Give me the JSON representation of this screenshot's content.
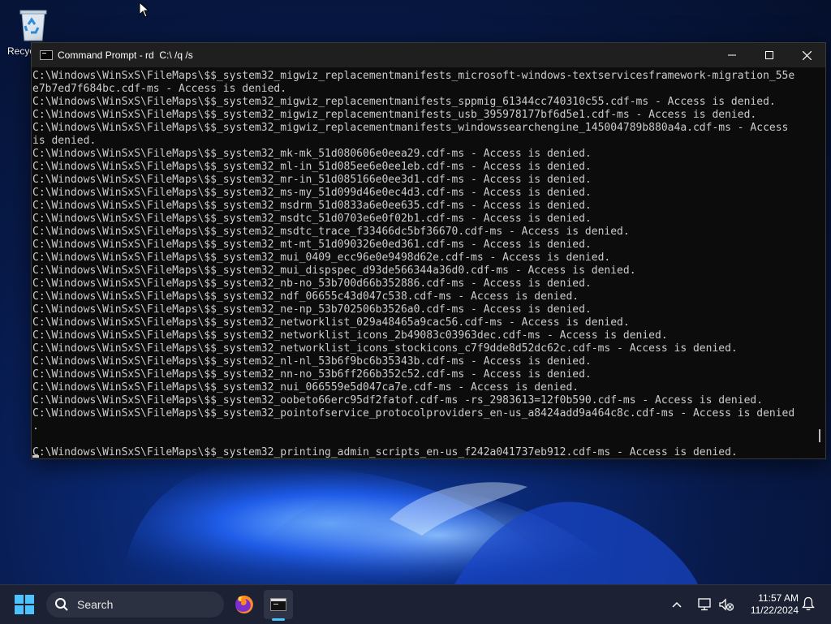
{
  "desktop": {
    "icons": [
      {
        "label": "Recyc",
        "icon": "recycle-bin-icon"
      }
    ]
  },
  "window": {
    "title": "Command Prompt - rd  C:\\ /q /s",
    "icon": "command-prompt-icon",
    "buttons": {
      "minimize": "minimize-icon",
      "maximize": "maximize-icon",
      "close": "close-icon"
    }
  },
  "console": {
    "lines": [
      "C:\\Windows\\WinSxS\\FileMaps\\$$_system32_migwiz_replacementmanifests_microsoft-windows-textservicesframework-migration_55e",
      "e7b7ed7f684bc.cdf-ms - Access is denied.",
      "C:\\Windows\\WinSxS\\FileMaps\\$$_system32_migwiz_replacementmanifests_sppmig_61344cc740310c55.cdf-ms - Access is denied.",
      "C:\\Windows\\WinSxS\\FileMaps\\$$_system32_migwiz_replacementmanifests_usb_395978177bf6d5e1.cdf-ms - Access is denied.",
      "C:\\Windows\\WinSxS\\FileMaps\\$$_system32_migwiz_replacementmanifests_windowssearchengine_145004789b880a4a.cdf-ms - Access",
      "is denied.",
      "C:\\Windows\\WinSxS\\FileMaps\\$$_system32_mk-mk_51d080606e0eea29.cdf-ms - Access is denied.",
      "C:\\Windows\\WinSxS\\FileMaps\\$$_system32_ml-in_51d085ee6e0ee1eb.cdf-ms - Access is denied.",
      "C:\\Windows\\WinSxS\\FileMaps\\$$_system32_mr-in_51d085166e0ee3d1.cdf-ms - Access is denied.",
      "C:\\Windows\\WinSxS\\FileMaps\\$$_system32_ms-my_51d099d46e0ec4d3.cdf-ms - Access is denied.",
      "C:\\Windows\\WinSxS\\FileMaps\\$$_system32_msdrm_51d0833a6e0ee635.cdf-ms - Access is denied.",
      "C:\\Windows\\WinSxS\\FileMaps\\$$_system32_msdtc_51d0703e6e0f02b1.cdf-ms - Access is denied.",
      "C:\\Windows\\WinSxS\\FileMaps\\$$_system32_msdtc_trace_f33466dc5bf36670.cdf-ms - Access is denied.",
      "C:\\Windows\\WinSxS\\FileMaps\\$$_system32_mt-mt_51d090326e0ed361.cdf-ms - Access is denied.",
      "C:\\Windows\\WinSxS\\FileMaps\\$$_system32_mui_0409_ecc96e0e9498d62e.cdf-ms - Access is denied.",
      "C:\\Windows\\WinSxS\\FileMaps\\$$_system32_mui_dispspec_d93de566344a36d0.cdf-ms - Access is denied.",
      "C:\\Windows\\WinSxS\\FileMaps\\$$_system32_nb-no_53b700d66b352886.cdf-ms - Access is denied.",
      "C:\\Windows\\WinSxS\\FileMaps\\$$_system32_ndf_06655c43d047c538.cdf-ms - Access is denied.",
      "C:\\Windows\\WinSxS\\FileMaps\\$$_system32_ne-np_53b702506b3526a0.cdf-ms - Access is denied.",
      "C:\\Windows\\WinSxS\\FileMaps\\$$_system32_networklist_029a48465a9cac56.cdf-ms - Access is denied.",
      "C:\\Windows\\WinSxS\\FileMaps\\$$_system32_networklist_icons_2b49083c03963dec.cdf-ms - Access is denied.",
      "C:\\Windows\\WinSxS\\FileMaps\\$$_system32_networklist_icons_stockicons_c7f9dde8d52dc62c.cdf-ms - Access is denied.",
      "C:\\Windows\\WinSxS\\FileMaps\\$$_system32_nl-nl_53b6f9bc6b35343b.cdf-ms - Access is denied.",
      "C:\\Windows\\WinSxS\\FileMaps\\$$_system32_nn-no_53b6ff266b352c52.cdf-ms - Access is denied.",
      "C:\\Windows\\WinSxS\\FileMaps\\$$_system32_nui_066559e5d047ca7e.cdf-ms - Access is denied.",
      "C:\\Windows\\WinSxS\\FileMaps\\$$_system32_oobeto66erc95df2fatof.cdf-ms -rs_2983613=12f0b590.cdf-ms - Access is denied.",
      "C:\\Windows\\WinSxS\\FileMaps\\$$_system32_pointofservice_protocolproviders_en-us_a8424add9a464c8c.cdf-ms - Access is denied",
      ".",
      "",
      "C:\\Windows\\WinSxS\\FileMaps\\$$_system32_printing_admin_scripts_en-us_f242a041737eb912.cdf-ms - Access is denied."
    ]
  },
  "taskbar": {
    "start_icon": "windows-start-icon",
    "search_placeholder": "Search",
    "apps": [
      {
        "name": "firefox",
        "icon": "firefox-icon"
      },
      {
        "name": "terminal",
        "icon": "terminal-icon",
        "active": true
      }
    ],
    "tray": {
      "chevron": "chevron-up-icon",
      "network": "network-icon",
      "volume": "volume-muted-icon",
      "time": "11:57 AM",
      "date": "11/22/2024",
      "notifications": "bell-icon"
    }
  },
  "colors": {
    "accent": "#4cc2ff",
    "console_bg": "#0c0c0c",
    "console_fg": "#cccccc",
    "titlebar_bg": "#1f1f1f",
    "taskbar_bg": "#1c2233"
  }
}
